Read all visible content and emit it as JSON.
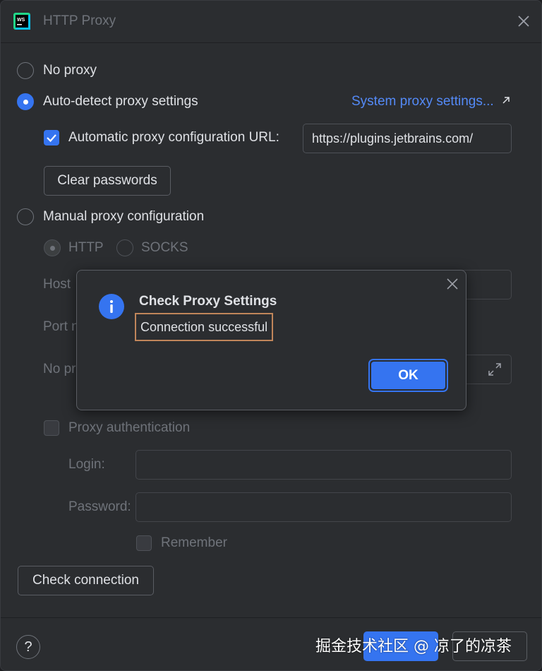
{
  "window": {
    "title": "HTTP Proxy",
    "app_icon": "webstorm-icon",
    "close_icon": "close-icon"
  },
  "options": {
    "no_proxy": {
      "label": "No proxy",
      "selected": false
    },
    "auto_detect": {
      "label": "Auto-detect proxy settings",
      "selected": true
    },
    "system_proxy_link": "System proxy settings...",
    "auto_config": {
      "label": "Automatic proxy configuration URL:",
      "checked": true,
      "url": "https://plugins.jetbrains.com/"
    },
    "clear_passwords": "Clear passwords",
    "manual": {
      "label": "Manual proxy configuration",
      "selected": false
    },
    "http_label": "HTTP",
    "socks_label": "SOCKS",
    "host_label": "Host",
    "port_label": "Port n",
    "no_proxy_label": "No pr",
    "proxy_auth": {
      "label": "Proxy authentication",
      "checked": false
    },
    "login_label": "Login:",
    "password_label": "Password:",
    "remember_label": "Remember",
    "check_connection": "Check connection"
  },
  "footer": {
    "help_symbol": "?",
    "watermark": "掘金技术社区 @ 凉了的凉茶"
  },
  "dialog": {
    "title": "Check Proxy Settings",
    "message": "Connection successful",
    "ok_label": "OK",
    "icon": "info-icon",
    "close_icon": "close-icon"
  },
  "colors": {
    "accent": "#3574f0",
    "link": "#548af7",
    "background": "#2b2d30",
    "highlight_border": "#c0855a"
  }
}
